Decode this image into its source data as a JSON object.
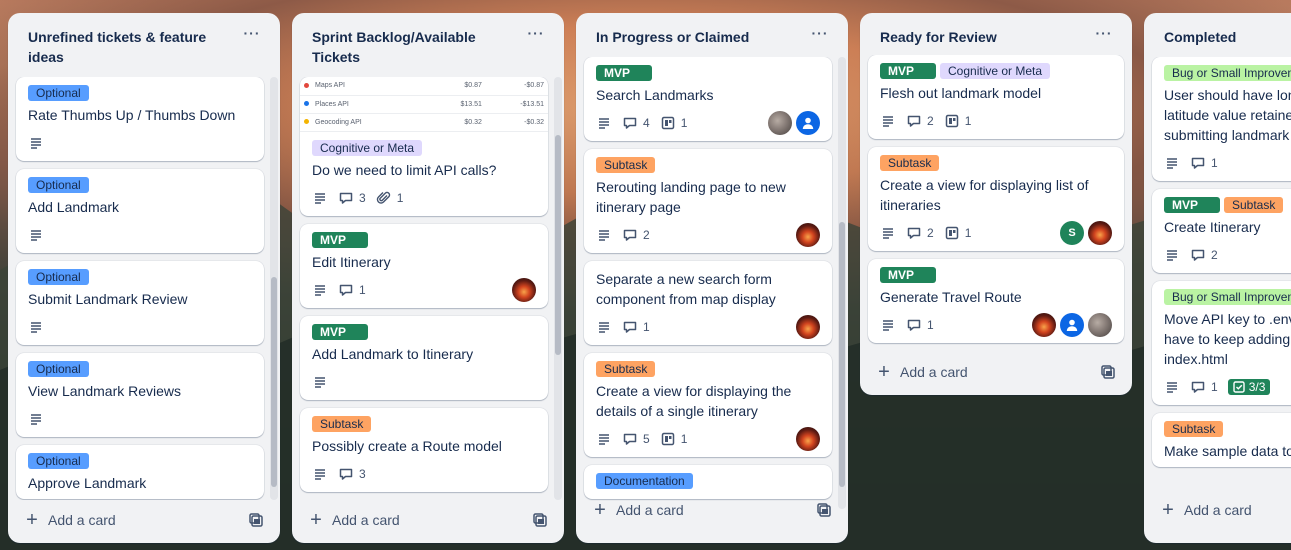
{
  "colors": {
    "optional": "#579dff",
    "mvp": "#1f845a",
    "cognitive": "#dfd8fd",
    "subtask": "#fea362",
    "documentation": "#579dff",
    "bug": "#baf3a3"
  },
  "icons": {
    "description": "description-icon",
    "comment": "comment-icon",
    "attachment": "attachment-icon",
    "checklist": "checklist-icon",
    "card_link": "card-link-icon",
    "add": "plus-icon",
    "template": "template-icon",
    "menu": "ellipsis-icon"
  },
  "lists": [
    {
      "title": "Unrefined tickets & feature ideas",
      "menu": "···",
      "add_label": "Add a card",
      "cards": [
        {
          "labels": [
            "Optional"
          ],
          "title": "Rate Thumbs Up / Thumbs Down"
        },
        {
          "labels": [
            "Optional"
          ],
          "title": "Add Landmark"
        },
        {
          "labels": [
            "Optional"
          ],
          "title": "Submit Landmark Review"
        },
        {
          "labels": [
            "Optional"
          ],
          "title": "View Landmark Reviews"
        },
        {
          "labels": [
            "Optional"
          ],
          "title": "Approve Landmark"
        }
      ]
    },
    {
      "title": "Sprint Backlog/Available Tickets",
      "menu": "···",
      "add_label": "Add a card",
      "api_rows": [
        {
          "name": "Maps API",
          "cost": "$0.87",
          "delta": "-$0.87",
          "color": "#e2483d"
        },
        {
          "name": "Places API",
          "cost": "$13.51",
          "delta": "-$13.51",
          "color": "#1a73e8"
        },
        {
          "name": "Geocoding API",
          "cost": "$0.32",
          "delta": "-$0.32",
          "color": "#f4b400"
        }
      ],
      "cards": [
        {
          "labels": [
            "Cognitive or Meta"
          ],
          "title": "Do we need to limit API calls?",
          "comments": "3",
          "attachments": "1"
        },
        {
          "labels": [
            "MVP"
          ],
          "title": "Edit Itinerary",
          "comments": "1"
        },
        {
          "labels": [
            "MVP"
          ],
          "title": "Add Landmark to Itinerary"
        },
        {
          "labels": [
            "Subtask"
          ],
          "title": "Possibly create a Route model",
          "comments": "3"
        }
      ]
    },
    {
      "title": "In Progress or Claimed",
      "menu": "···",
      "add_label": "Add a card",
      "cards": [
        {
          "labels": [
            "MVP"
          ],
          "title": "Search Landmarks",
          "comments": "4",
          "links": "1"
        },
        {
          "labels": [
            "Subtask"
          ],
          "title": "Rerouting landing page to new itinerary page",
          "comments": "2"
        },
        {
          "title": "Separate a new search form component from map display",
          "comments": "1"
        },
        {
          "labels": [
            "Subtask"
          ],
          "title": "Create a view for displaying the details of a single itinerary",
          "comments": "5",
          "links": "1"
        },
        {
          "labels": [
            "Documentation"
          ],
          "title": ""
        }
      ]
    },
    {
      "title": "Ready for Review",
      "menu": "···",
      "add_label": "Add a card",
      "cards": [
        {
          "labels": [
            "MVP",
            "Cognitive or Meta"
          ],
          "title": "Flesh out landmark model",
          "comments": "2",
          "links": "1"
        },
        {
          "labels": [
            "Subtask"
          ],
          "title": "Create a view for displaying list of itineraries",
          "comments": "2",
          "links": "1",
          "member_letter": "S"
        },
        {
          "labels": [
            "MVP"
          ],
          "title": "Generate Travel Route",
          "comments": "1"
        }
      ]
    },
    {
      "title": "Completed",
      "add_label": "Add a card",
      "cards": [
        {
          "labels": [
            "Bug or Small Improvement"
          ],
          "title": "User should have longitude and latitude value retained when submitting landmark form",
          "comments": "1"
        },
        {
          "labels": [
            "MVP",
            "Subtask"
          ],
          "title": "Create Itinerary",
          "comments": "2"
        },
        {
          "labels": [
            "Bug or Small Improvement"
          ],
          "title": "Move API key to .env so we don't have to keep adding it directly to index.html",
          "comments": "1",
          "checklist": "3/3"
        },
        {
          "labels": [
            "Subtask"
          ],
          "title": "Make sample data to be used by all"
        }
      ]
    }
  ]
}
